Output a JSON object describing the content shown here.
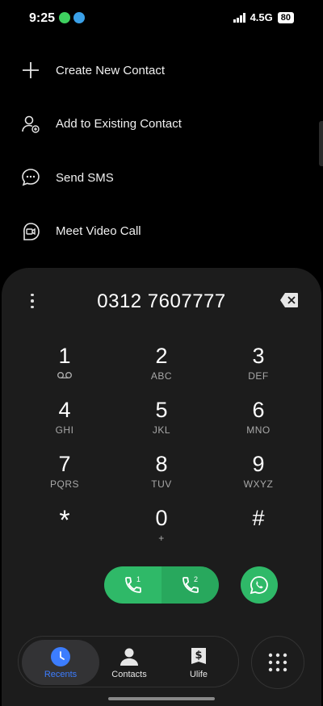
{
  "status_bar": {
    "time": "9:25",
    "network": "4.5G",
    "battery": "80"
  },
  "menu": {
    "items": [
      {
        "label": "Create New Contact",
        "icon": "plus-icon"
      },
      {
        "label": "Add to Existing Contact",
        "icon": "add-person-icon"
      },
      {
        "label": "Send SMS",
        "icon": "chat-bubble-icon"
      },
      {
        "label": "Meet Video Call",
        "icon": "video-call-icon"
      }
    ]
  },
  "dialer": {
    "number": "0312 7607777",
    "keys": [
      {
        "digit": "1",
        "letters": ""
      },
      {
        "digit": "2",
        "letters": "ABC"
      },
      {
        "digit": "3",
        "letters": "DEF"
      },
      {
        "digit": "4",
        "letters": "GHI"
      },
      {
        "digit": "5",
        "letters": "JKL"
      },
      {
        "digit": "6",
        "letters": "MNO"
      },
      {
        "digit": "7",
        "letters": "PQRS"
      },
      {
        "digit": "8",
        "letters": "TUV"
      },
      {
        "digit": "9",
        "letters": "WXYZ"
      },
      {
        "digit": "*",
        "letters": ""
      },
      {
        "digit": "0",
        "letters": "+"
      },
      {
        "digit": "#",
        "letters": ""
      }
    ],
    "call_sim1": "1",
    "call_sim2": "2"
  },
  "bottom_nav": {
    "items": [
      {
        "label": "Recents",
        "active": true
      },
      {
        "label": "Contacts",
        "active": false
      },
      {
        "label": "Ulife",
        "active": false
      }
    ]
  },
  "colors": {
    "accent": "#3c7dff",
    "call_green": "#2fb968",
    "sheet_bg": "#1c1c1c"
  }
}
